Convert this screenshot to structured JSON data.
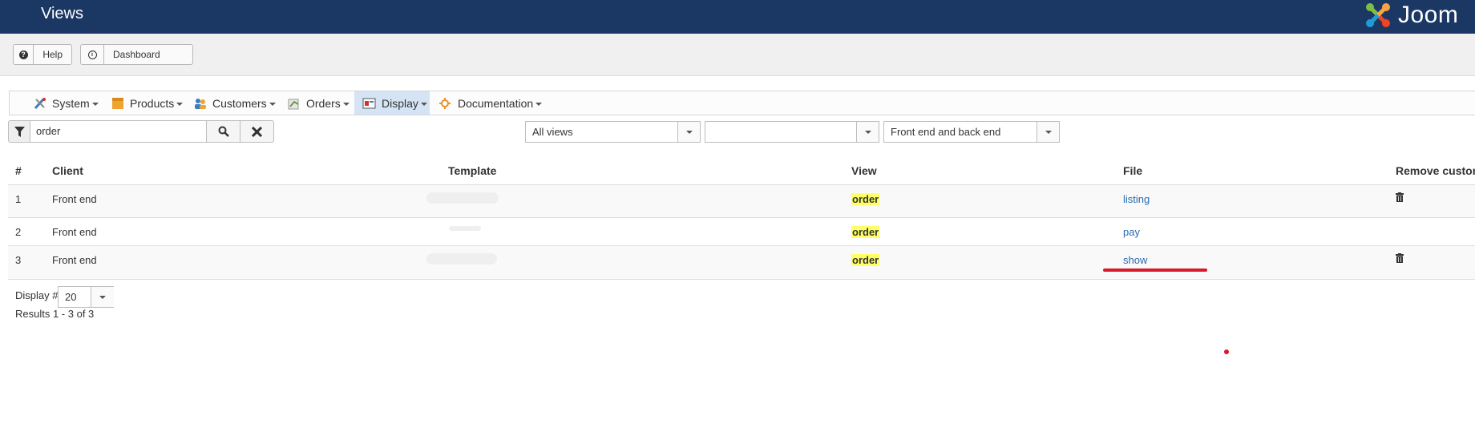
{
  "header": {
    "title": "Views",
    "logo_text": "Joom"
  },
  "toolbar": {
    "help_label": "Help",
    "dashboard_label": "Dashboard"
  },
  "menu": {
    "items": [
      {
        "label": "System",
        "icon": "tools-icon"
      },
      {
        "label": "Products",
        "icon": "products-icon"
      },
      {
        "label": "Customers",
        "icon": "customers-icon"
      },
      {
        "label": "Orders",
        "icon": "orders-icon"
      },
      {
        "label": "Display",
        "icon": "display-icon",
        "active": true
      },
      {
        "label": "Documentation",
        "icon": "documentation-icon"
      }
    ]
  },
  "filters": {
    "search_value": "order",
    "views_select": "All views",
    "template_select": "",
    "client_select": "Front end and back end"
  },
  "table": {
    "headers": {
      "num": "#",
      "client": "Client",
      "template": "Template",
      "view": "View",
      "file": "File",
      "remove": "Remove custom"
    },
    "rows": [
      {
        "num": "1",
        "client": "Front end",
        "template": "",
        "view": "order",
        "file": "listing",
        "removable": true
      },
      {
        "num": "2",
        "client": "Front end",
        "template": "",
        "view": "order",
        "file": "pay",
        "removable": false
      },
      {
        "num": "3",
        "client": "Front end",
        "template": "",
        "view": "order",
        "file": "show",
        "removable": true
      }
    ]
  },
  "footer": {
    "display_label": "Display #",
    "display_value": "20",
    "results": "Results 1 - 3 of 3"
  },
  "colors": {
    "header_bg": "#1b3764",
    "highlight": "#ffff66",
    "link": "#2a6ab0",
    "annotation_red": "#d61a2a"
  }
}
